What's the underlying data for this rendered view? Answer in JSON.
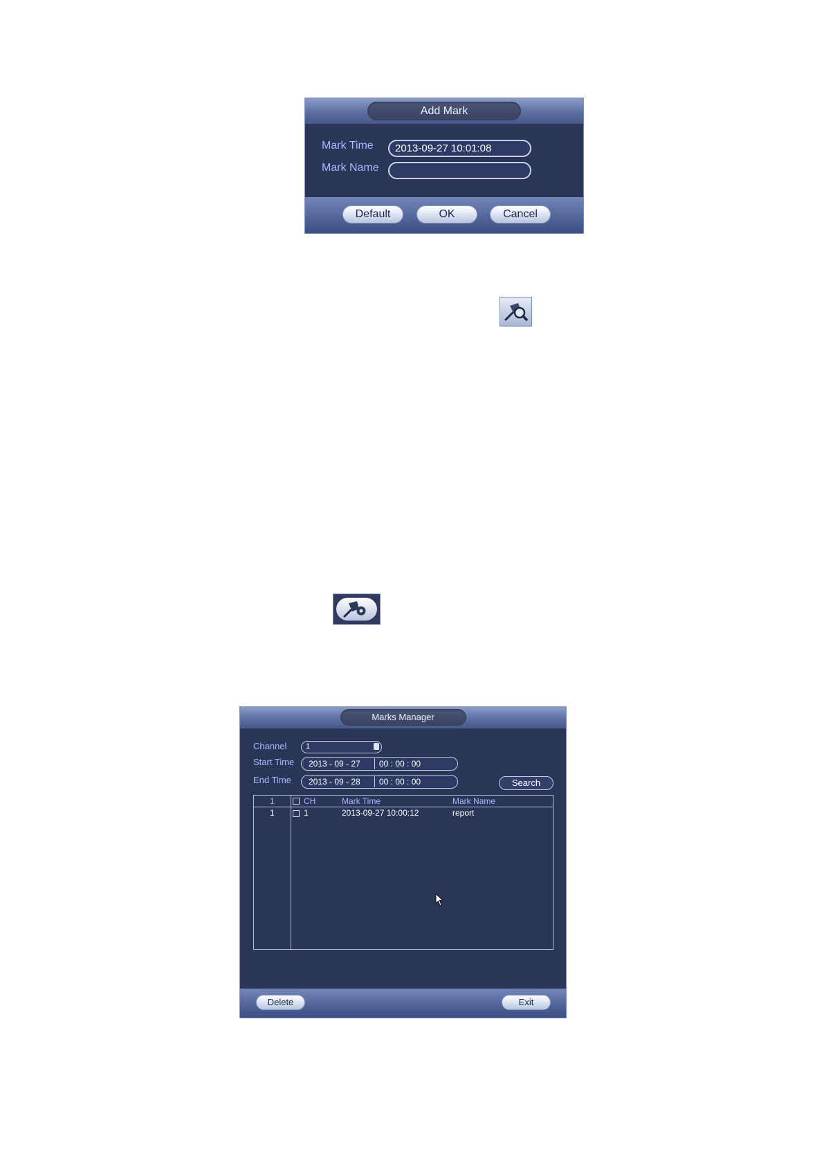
{
  "add_mark": {
    "title": "Add Mark",
    "mark_time_label": "Mark Time",
    "mark_time_value": "2013-09-27 10:01:08",
    "mark_name_label": "Mark Name",
    "mark_name_value": "",
    "buttons": {
      "default": "Default",
      "ok": "OK",
      "cancel": "Cancel"
    }
  },
  "icons": {
    "mark_search": "mark-search-icon",
    "mark_manager": "mark-manager-icon"
  },
  "marks_manager": {
    "title": "Marks Manager",
    "channel_label": "Channel",
    "channel_value": "1",
    "start_time_label": "Start Time",
    "start_date": "2013 - 09 - 27",
    "start_time": "00 : 00 : 00",
    "end_time_label": "End Time",
    "end_date": "2013 - 09 - 28",
    "end_time": "00 : 00 : 00",
    "search_button": "Search",
    "columns": {
      "index": "1",
      "ch": "CH",
      "mark_time": "Mark Time",
      "mark_name": "Mark Name"
    },
    "rows": [
      {
        "index": "1",
        "ch": "1",
        "mark_time": "2013-09-27 10:00:12",
        "mark_name": "report"
      }
    ],
    "delete_button": "Delete",
    "exit_button": "Exit"
  }
}
